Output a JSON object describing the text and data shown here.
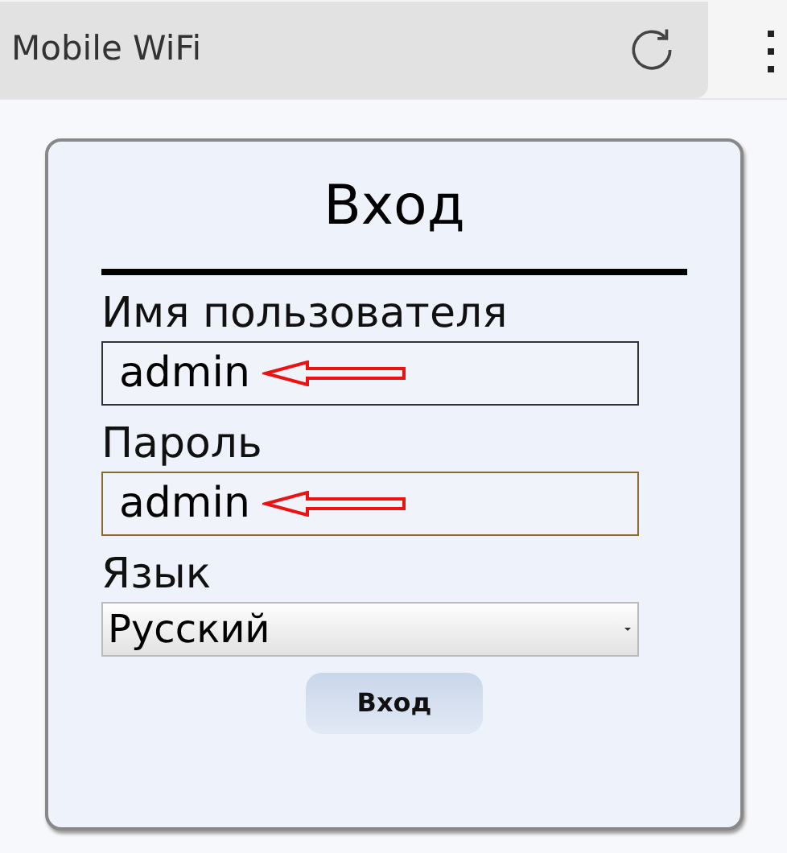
{
  "browser_bar": {
    "title": "Mobile WiFi"
  },
  "login_panel": {
    "title": "Вход",
    "fields": [
      {
        "label": "Имя пользователя",
        "value": "admin",
        "focused": false,
        "annotated": true
      },
      {
        "label": "Пароль",
        "value": "admin",
        "focused": true,
        "annotated": true
      }
    ],
    "language": {
      "label": "Язык",
      "value": "Русский"
    },
    "submit": "Вход"
  }
}
